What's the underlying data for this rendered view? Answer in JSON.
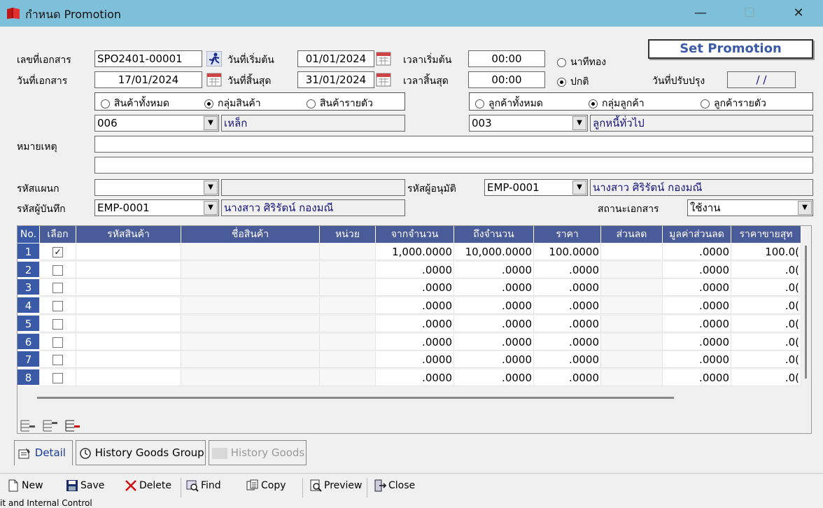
{
  "window": {
    "title": "กำหนด Promotion",
    "min": "—",
    "max": "☐",
    "close": "✕"
  },
  "form": {
    "doc_no_label": "เลขที่เอกสาร",
    "doc_no": "SPO2401-00001",
    "doc_date_label": "วันที่เอกสาร",
    "doc_date": "17/01/2024",
    "start_date_label": "วันที่เริ่มต้น",
    "start_date": "01/01/2024",
    "end_date_label": "วันที่สิ้นสุด",
    "end_date": "31/01/2024",
    "start_time_label": "เวลาเริ่มต้น",
    "start_time": "00:00",
    "end_time_label": "เวลาสิ้นสุด",
    "end_time": "00:00",
    "mode_golden": "นาทีทอง",
    "mode_normal": "ปกติ",
    "set_promotion": "Set Promotion",
    "update_date_label": "วันที่ปรับปรุง",
    "update_date": "/ /",
    "product_all": "สินค้าทั้งหมด",
    "product_group": "กลุ่มสินค้า",
    "product_item": "สินค้ารายตัว",
    "customer_all": "ลูกค้าทั้งหมด",
    "customer_group": "กลุ่มลูกค้า",
    "customer_item": "ลูกค้ารายตัว",
    "product_group_code": "006",
    "product_group_name": "เหล็ก",
    "customer_group_code": "003",
    "customer_group_name": "ลูกหนี้ทั่วไป",
    "note_label": "หมายเหตุ",
    "note1": "",
    "note2": "",
    "dept_label": "รหัสแผนก",
    "dept_code": "",
    "dept_name": "",
    "approver_label": "รหัสผู้อนุมัติ",
    "approver_code": "EMP-0001",
    "approver_name": "นางสาว ศิริรัตน์ กองมณี",
    "recorder_label": "รหัสผู้บันทึก",
    "recorder_code": "EMP-0001",
    "recorder_name": "นางสาว ศิริรัตน์ กองมณี",
    "status_label": "สถานะเอกสาร",
    "status_value": "ใช้งาน"
  },
  "grid": {
    "headers": [
      "No.",
      "เลือก",
      "รหัสสินค้า",
      "ชื่อสินค้า",
      "หน่วย",
      "จากจำนวน",
      "ถึงจำนวน",
      "ราคา",
      "ส่วนลด",
      "มูลค่าส่วนลด",
      "ราคาขายสุท"
    ],
    "rows": [
      {
        "no": "1",
        "checked": "✓",
        "code": "",
        "name": "",
        "unit": "",
        "from": "1,000.0000",
        "to": "10,000.0000",
        "price": "100.0000",
        "discount": "",
        "disc_value": ".0000",
        "net": "100.0("
      },
      {
        "no": "2",
        "checked": "",
        "code": "",
        "name": "",
        "unit": "",
        "from": ".0000",
        "to": ".0000",
        "price": ".0000",
        "discount": "",
        "disc_value": ".0000",
        "net": ".0("
      },
      {
        "no": "3",
        "checked": "",
        "code": "",
        "name": "",
        "unit": "",
        "from": ".0000",
        "to": ".0000",
        "price": ".0000",
        "discount": "",
        "disc_value": ".0000",
        "net": ".0("
      },
      {
        "no": "4",
        "checked": "",
        "code": "",
        "name": "",
        "unit": "",
        "from": ".0000",
        "to": ".0000",
        "price": ".0000",
        "discount": "",
        "disc_value": ".0000",
        "net": ".0("
      },
      {
        "no": "5",
        "checked": "",
        "code": "",
        "name": "",
        "unit": "",
        "from": ".0000",
        "to": ".0000",
        "price": ".0000",
        "discount": "",
        "disc_value": ".0000",
        "net": ".0("
      },
      {
        "no": "6",
        "checked": "",
        "code": "",
        "name": "",
        "unit": "",
        "from": ".0000",
        "to": ".0000",
        "price": ".0000",
        "discount": "",
        "disc_value": ".0000",
        "net": ".0("
      },
      {
        "no": "7",
        "checked": "",
        "code": "",
        "name": "",
        "unit": "",
        "from": ".0000",
        "to": ".0000",
        "price": ".0000",
        "discount": "",
        "disc_value": ".0000",
        "net": ".0("
      },
      {
        "no": "8",
        "checked": "",
        "code": "",
        "name": "",
        "unit": "",
        "from": ".0000",
        "to": ".0000",
        "price": ".0000",
        "discount": "",
        "disc_value": ".0000",
        "net": ".0("
      }
    ]
  },
  "tabs": [
    "Detail",
    "History Goods Group",
    "History Goods"
  ],
  "toolbar": {
    "new": "New",
    "save": "Save",
    "delete": "Delete",
    "find": "Find",
    "copy": "Copy",
    "preview": "Preview",
    "close": "Close"
  },
  "statusbar": {
    "text": "it and Internal Control"
  },
  "colors": {
    "titlebar": "#7ebfd9",
    "grid_header": "#4a5b9a",
    "row_number": "#3a5aa8",
    "set_promotion_text": "#3b5aa8"
  },
  "icons": [
    "app-book-icon",
    "runner-icon",
    "calendar-icon",
    "dropdown-arrow-icon",
    "new-doc-icon",
    "floppy-save-icon",
    "red-x-delete-icon",
    "find-icon",
    "copy-icon",
    "preview-icon",
    "exit-door-icon"
  ]
}
